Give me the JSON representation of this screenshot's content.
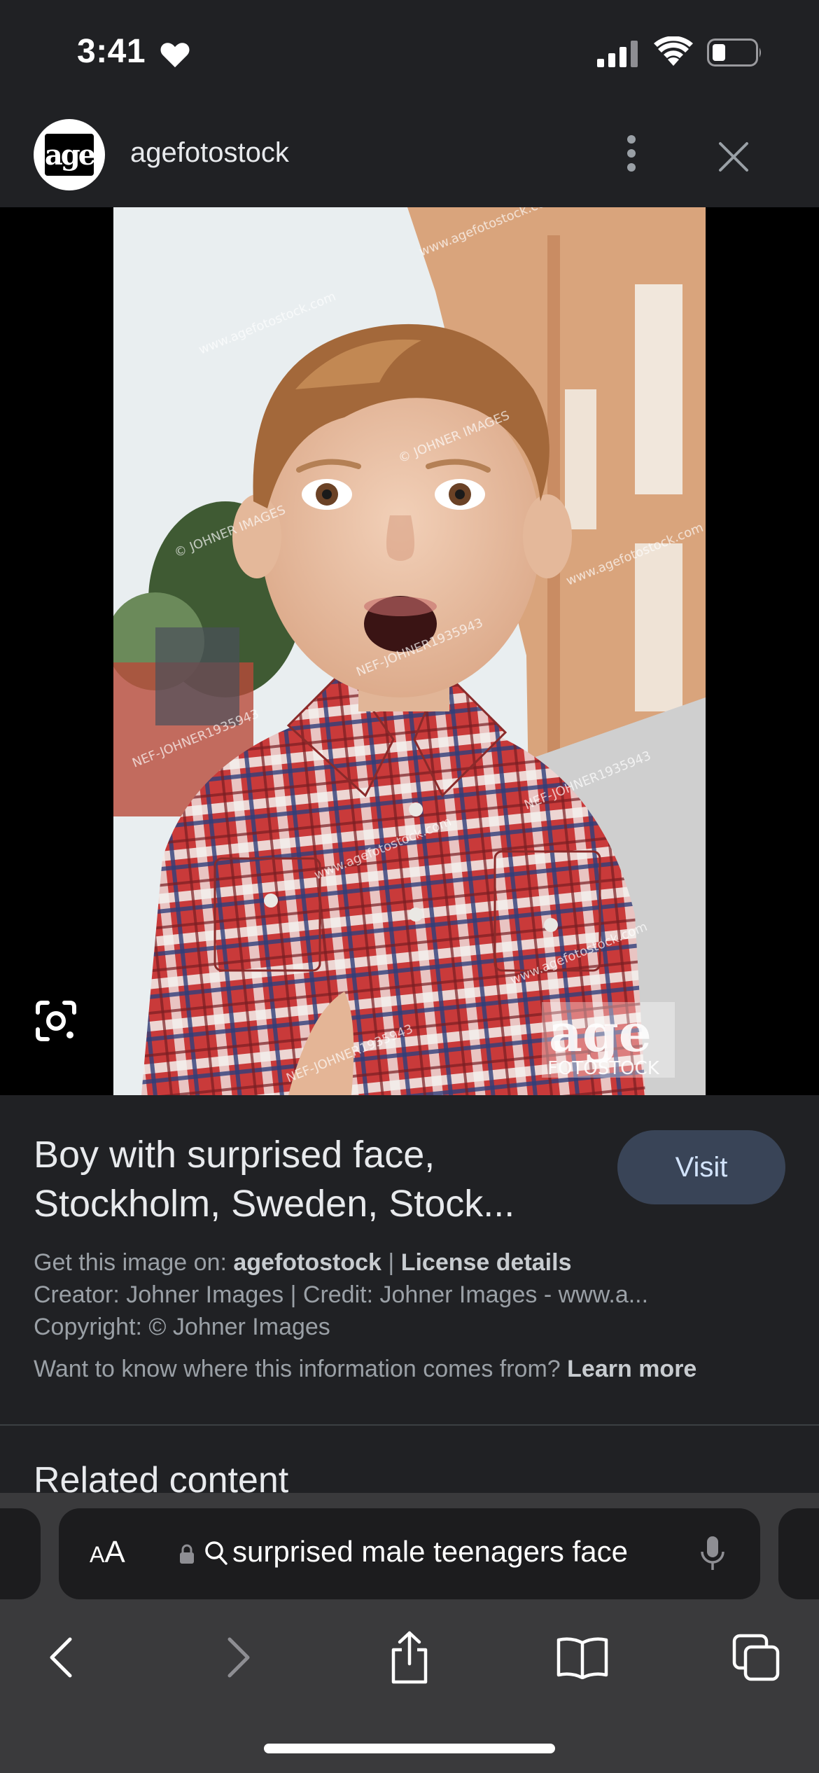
{
  "status_bar": {
    "time": "3:41"
  },
  "source": {
    "name": "agefotostock",
    "logo_text": "age"
  },
  "image": {
    "watermarks": [
      "www.agefotostock.com",
      "© JOHNER IMAGES",
      "NEF-JOHNER1935943"
    ],
    "corner_logo_top": "age",
    "corner_logo_bottom": "FOTOSTOCK"
  },
  "info": {
    "title": "Boy with surprised face, Stockholm, Sweden, Stock...",
    "visit_label": "Visit",
    "get_image_prefix": "Get this image on: ",
    "get_image_source": "agefotostock",
    "separator": " | ",
    "license_details": "License details",
    "creator_line": "Creator: Johner Images | Credit: Johner Images - www.a...",
    "copyright_line": "Copyright: © Johner Images",
    "want_to_know": "Want to know where this information comes from? ",
    "learn_more": "Learn more"
  },
  "related": {
    "heading": "Related content"
  },
  "browser": {
    "aa_large": "A",
    "aa_small": "A",
    "address_text": "surprised male teenagers face"
  }
}
